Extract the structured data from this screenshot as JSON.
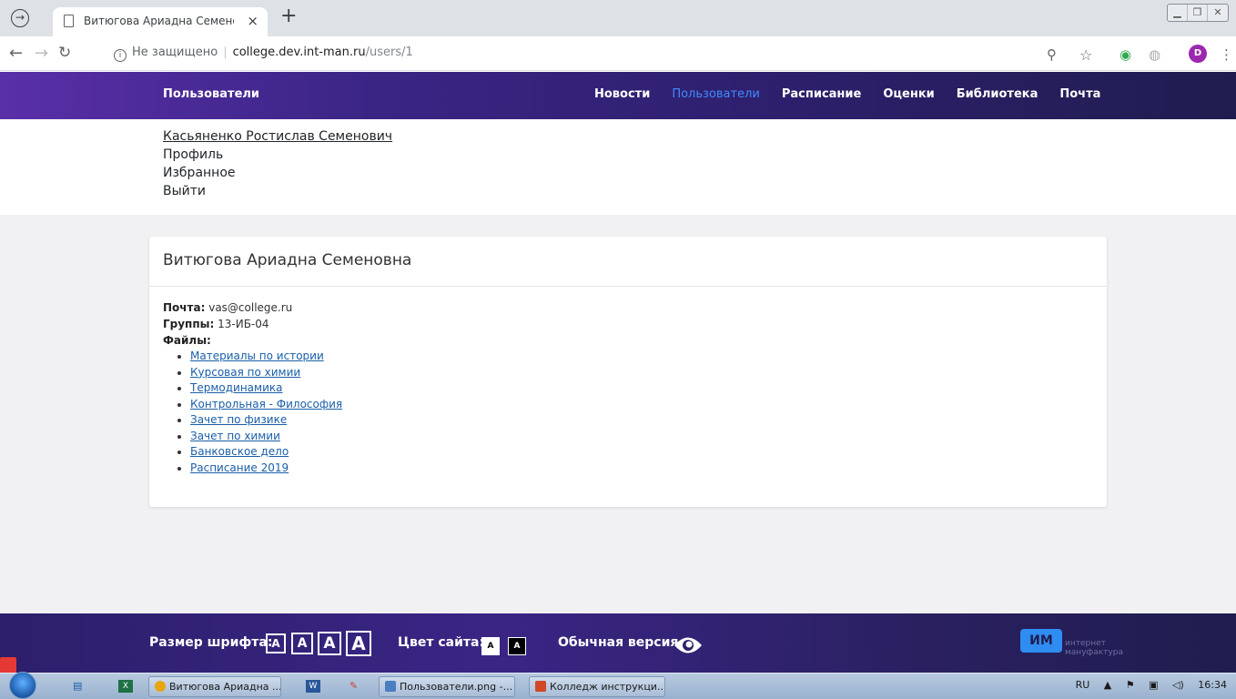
{
  "browser": {
    "tab_title": "Витюгова Ариадна Семеновна",
    "tab_close": "×",
    "new_tab": "+",
    "not_secure": "Не защищено",
    "url_host": "college.dev.int-man.ru",
    "url_path": "/users/1",
    "profile_initial": "D"
  },
  "header": {
    "brand": "Пользователи",
    "nav": [
      "Новости",
      "Пользователи",
      "Расписание",
      "Оценки",
      "Библиотека",
      "Почта"
    ],
    "active_nav": "Пользователи"
  },
  "user_menu": {
    "name": "Касьяненко Ростислав Семенович",
    "items": [
      "Профиль",
      "Избранное",
      "Выйти"
    ]
  },
  "card": {
    "title": "Витюгова Ариадна Семеновна",
    "email_label": "Почта:",
    "email": "vas@college.ru",
    "groups_label": "Группы:",
    "groups": "13-ИБ-04",
    "files_label": "Файлы:",
    "files": [
      "Материалы по истории",
      "Курсовая по химии",
      "Термодинамика",
      "Контрольная - Философия",
      "Зачет по физике",
      "Зачет по химии",
      "Банковское дело",
      "Расписание 2019"
    ]
  },
  "footer": {
    "font_size_label": "Размер шрифта:",
    "font_btn": "A",
    "color_label": "Цвет сайта:",
    "normal_version": "Обычная версия",
    "logo": "ИМ",
    "logo_text_1": "интернет",
    "logo_text_2": "мануфактура"
  },
  "taskbar": {
    "tasks": [
      "Витюгова Ариадна ...",
      "Пользователи.png -...",
      "Колледж инструкци..."
    ],
    "lang": "RU",
    "time": "16:34"
  }
}
